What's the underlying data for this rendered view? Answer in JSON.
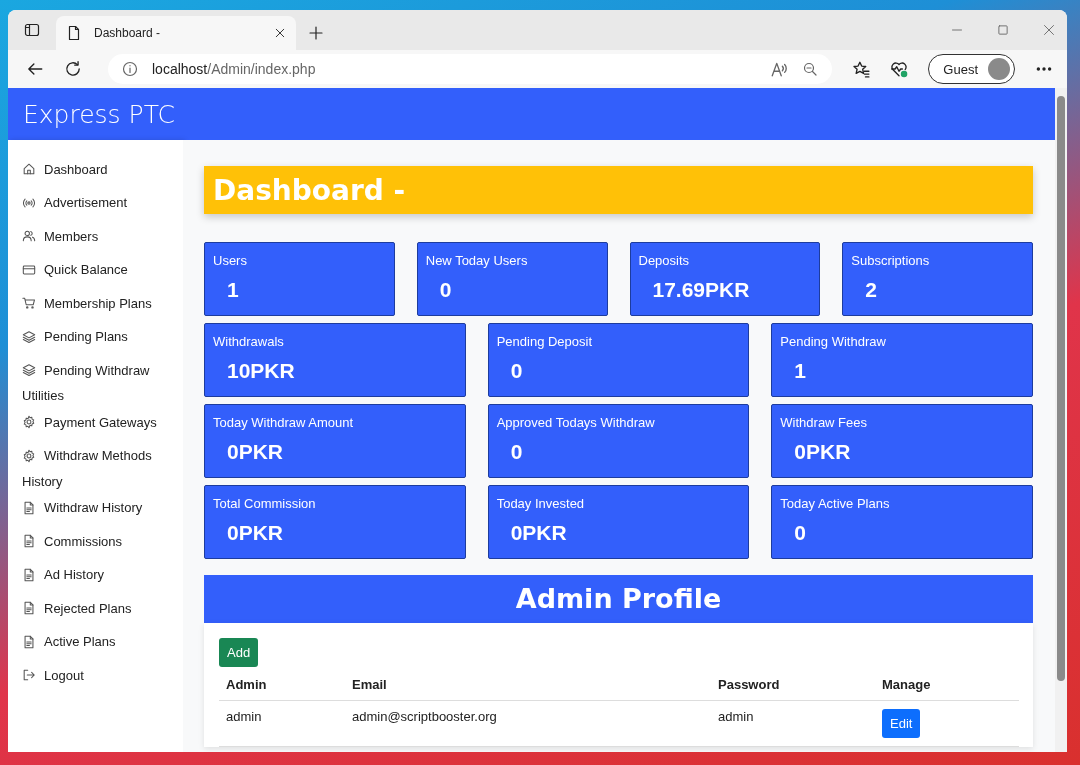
{
  "browser": {
    "tab_title": "Dashboard -",
    "url_host": "localhost",
    "url_path": "/Admin/index.php",
    "profile": "Guest"
  },
  "site_title": "Express PTC",
  "sidebar": [
    {
      "kind": "home",
      "label": "Dashboard"
    },
    {
      "kind": "broadcast",
      "label": "Advertisement"
    },
    {
      "kind": "people",
      "label": "Members"
    },
    {
      "kind": "card",
      "label": "Quick Balance"
    },
    {
      "kind": "cart",
      "label": "Membership Plans"
    },
    {
      "kind": "layers",
      "label": "Pending Plans"
    },
    {
      "kind": "layers",
      "label": "Pending Withdraw"
    },
    {
      "kind": "heading",
      "label": "Utilities"
    },
    {
      "kind": "gear",
      "label": "Payment Gateways"
    },
    {
      "kind": "gear",
      "label": "Withdraw Methods"
    },
    {
      "kind": "heading",
      "label": "History"
    },
    {
      "kind": "document",
      "label": "Withdraw History"
    },
    {
      "kind": "document",
      "label": "Commissions"
    },
    {
      "kind": "document",
      "label": "Ad History"
    },
    {
      "kind": "document",
      "label": "Rejected Plans"
    },
    {
      "kind": "document",
      "label": "Active Plans"
    },
    {
      "kind": "logout",
      "label": "Logout"
    }
  ],
  "page_title": "Dashboard -",
  "stat_rows": [
    [
      {
        "label": "Users",
        "value": "1"
      },
      {
        "label": "New Today Users",
        "value": "0"
      },
      {
        "label": "Deposits",
        "value": "17.69PKR"
      },
      {
        "label": "Subscriptions",
        "value": "2"
      }
    ],
    [
      {
        "label": "Withdrawals",
        "value": "10PKR"
      },
      {
        "label": "Pending Deposit",
        "value": "0"
      },
      {
        "label": "Pending Withdraw",
        "value": "1"
      }
    ],
    [
      {
        "label": "Today Withdraw Amount",
        "value": "0PKR"
      },
      {
        "label": "Approved Todays Withdraw",
        "value": "0"
      },
      {
        "label": "Withdraw Fees",
        "value": "0PKR"
      }
    ],
    [
      {
        "label": "Total Commission",
        "value": "0PKR"
      },
      {
        "label": "Today Invested",
        "value": "0PKR"
      },
      {
        "label": "Today Active Plans",
        "value": "0"
      }
    ]
  ],
  "profile": {
    "title": "Admin Profile",
    "add_button": "Add",
    "columns": [
      "Admin",
      "Email",
      "Password",
      "Manage"
    ],
    "rows": [
      {
        "cells": [
          "admin",
          "admin@scriptbooster.org",
          "admin"
        ],
        "action": "Edit"
      }
    ]
  }
}
